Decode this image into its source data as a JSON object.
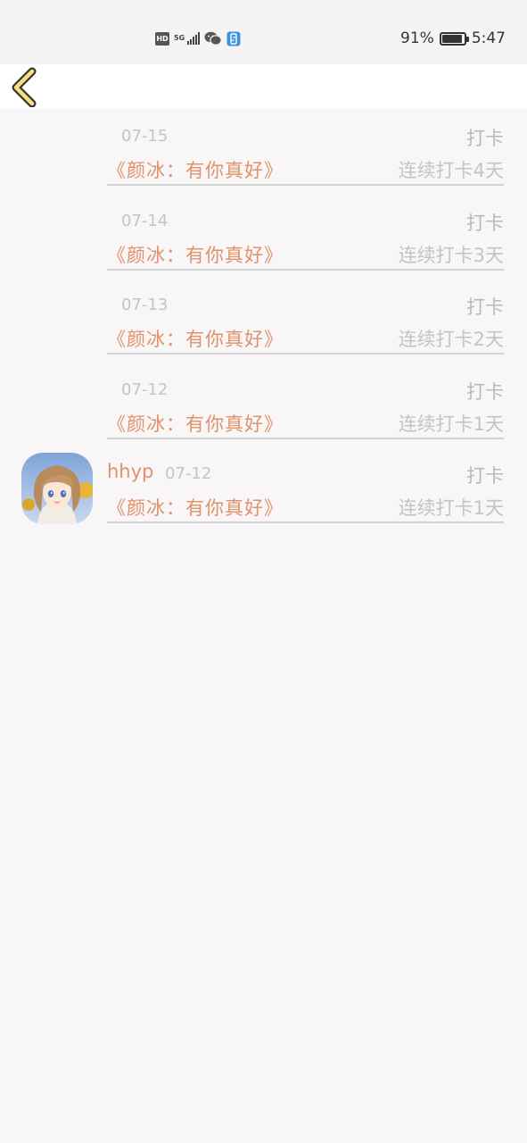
{
  "status_bar": {
    "hd": "HD",
    "network": "5G",
    "battery_text": "91%",
    "battery_level": 0.91,
    "time": "5:47",
    "icons": [
      "hd-icon",
      "5g-signal-icon",
      "wechat-icon",
      "phone-clone-icon",
      "battery-icon"
    ]
  },
  "nav": {
    "back_icon": "chevron-left-icon",
    "accent": "#f7e27a"
  },
  "entries": [
    {
      "date": "07-15",
      "action": "打卡",
      "title": "《颜冰：有你真好》",
      "streak": "连续打卡4天"
    },
    {
      "date": "07-14",
      "action": "打卡",
      "title": "《颜冰：有你真好》",
      "streak": "连续打卡3天"
    },
    {
      "date": "07-13",
      "action": "打卡",
      "title": "《颜冰：有你真好》",
      "streak": "连续打卡2天"
    },
    {
      "date": "07-12",
      "action": "打卡",
      "title": "《颜冰：有你真好》",
      "streak": "连续打卡1天"
    },
    {
      "user": "hhyp",
      "date": "07-12",
      "action": "打卡",
      "title": "《颜冰：有你真好》",
      "streak": "连续打卡1天"
    }
  ],
  "colors": {
    "accent": "#e0926a",
    "muted": "#c4c4c4",
    "background": "#f8f6f6"
  }
}
